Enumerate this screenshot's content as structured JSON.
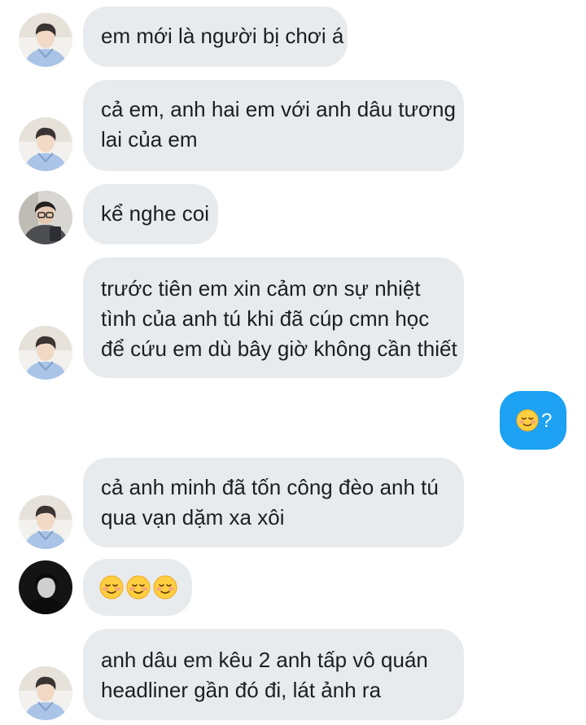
{
  "messages": [
    {
      "sender": "boy-light",
      "lines": [
        "em mới là người bị chơi á"
      ]
    },
    {
      "sender": "boy-light",
      "lines": [
        "cả em, anh hai em với anh dâu tương",
        "lai của em"
      ]
    },
    {
      "sender": "boy-glasses",
      "lines": [
        "kể nghe coi"
      ]
    },
    {
      "sender": "boy-light",
      "lines": [
        "trước tiên em xin cảm ơn sự nhiệt",
        "tình của anh tú khi đã cúp cmn học",
        "để cứu em dù bây giờ không cần thiết"
      ]
    },
    {
      "sender": "me",
      "emoji": "smiling-face-icon",
      "text": "?"
    },
    {
      "sender": "boy-light",
      "lines": [
        "cả anh minh đã tốn công đèo anh tú",
        "qua vạn dặm xa xôi"
      ]
    },
    {
      "sender": "boy-dark",
      "emoji_count": 3,
      "emoji": "smiling-face-icon"
    },
    {
      "sender": "boy-light",
      "lines": [
        "anh dâu em kêu 2 anh tấp vô quán",
        "headliner gần đó đi, lát ảnh ra"
      ]
    }
  ],
  "colors": {
    "incoming_bubble": "#e8ebee",
    "outgoing_bubble": "#1da1f2",
    "text": "#1c1e21"
  }
}
